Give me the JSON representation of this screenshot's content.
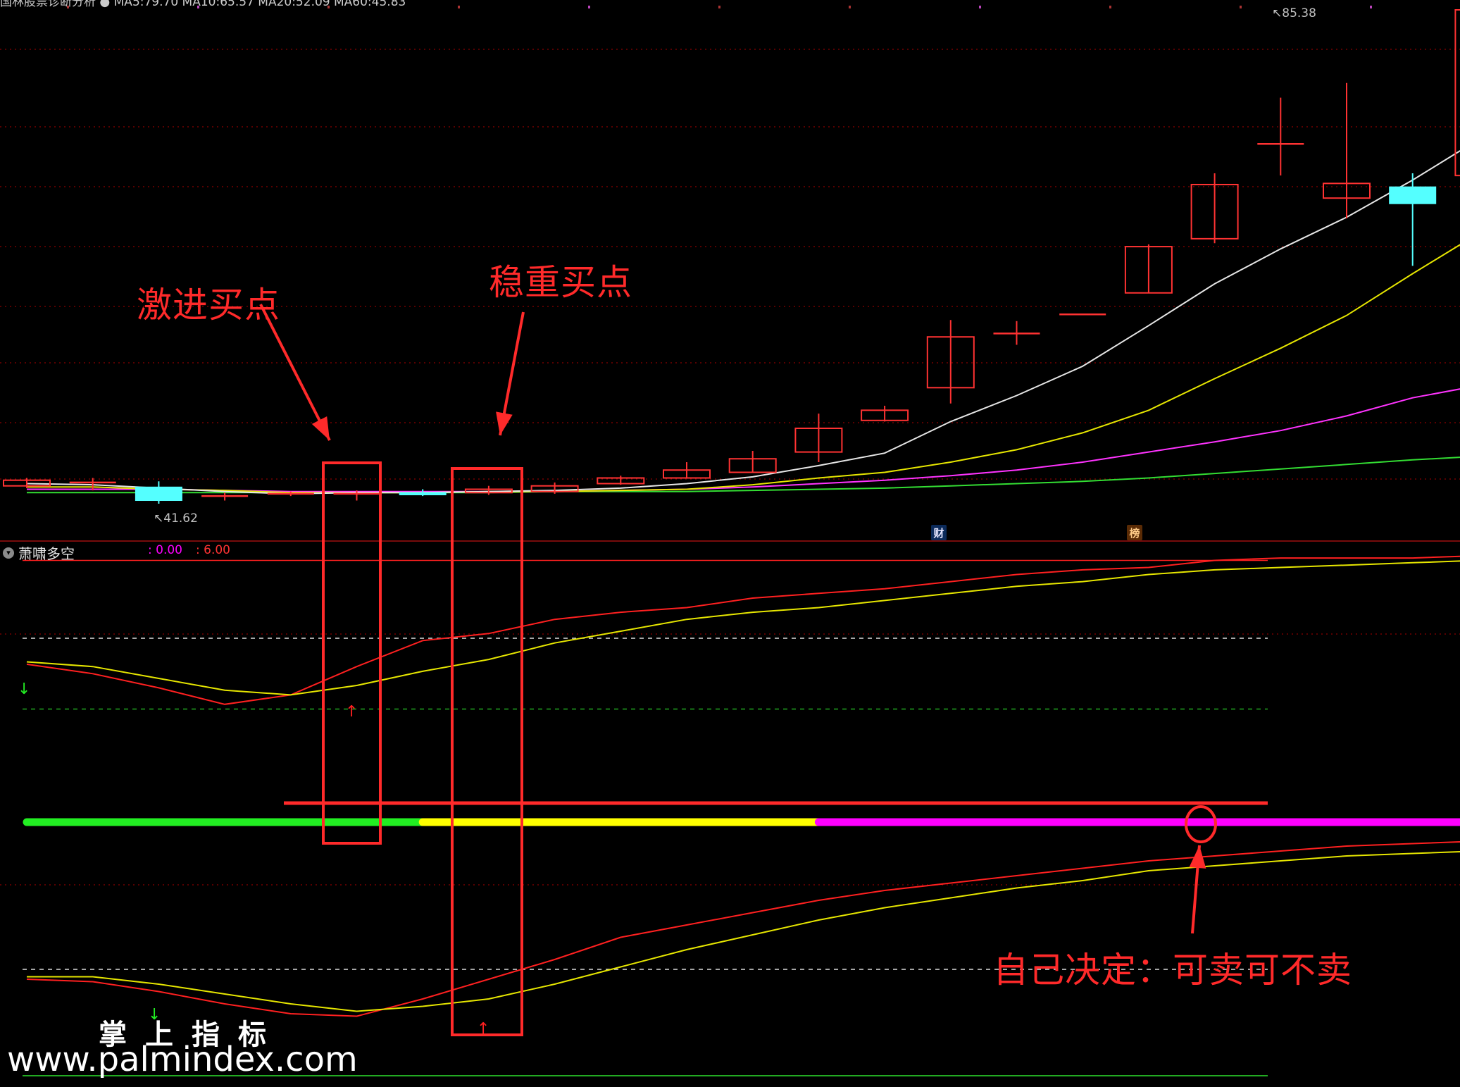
{
  "header": {
    "legend_text": "国林股票诊断分析 ● MA5:79.70 MA10:65.57 MA20:52.09 MA60:45.83"
  },
  "indicator": {
    "title": "萧啸多空",
    "value1": ": 0.00",
    "value2": ": 6.00"
  },
  "price_labels": {
    "high": "85.38",
    "low": "41.62"
  },
  "badges": {
    "cai": "财",
    "bang": "榜"
  },
  "annotations": {
    "aggressive": "激进买点",
    "steady": "稳重买点",
    "decide": "自己决定：可卖可不卖"
  },
  "watermark": {
    "cn": "掌上指标",
    "url": "www.palmindex.com"
  },
  "colors": {
    "background": "#000000",
    "up_candle": "#ff3232",
    "down_candle": "#54ffff",
    "ma5": "#e6e6e6",
    "ma10": "#e6e600",
    "ma20": "#ff33ff",
    "ma60": "#33dd33",
    "annotation": "#ff2a2a",
    "grid": "#8b0000"
  },
  "chart_data": [
    {
      "type": "candlestick",
      "title": "",
      "price_axis_max": 85.38,
      "price_axis_min": 41.62,
      "candles": [
        {
          "o": 43.2,
          "c": 43.7,
          "h": 43.9,
          "l": 43.0
        },
        {
          "o": 43.5,
          "c": 43.5,
          "h": 43.9,
          "l": 42.8
        },
        {
          "o": 43.1,
          "c": 41.9,
          "h": 43.6,
          "l": 41.62
        },
        {
          "o": 42.2,
          "c": 42.3,
          "h": 42.6,
          "l": 41.9
        },
        {
          "o": 42.4,
          "c": 42.5,
          "h": 42.7,
          "l": 42.3
        },
        {
          "o": 42.5,
          "c": 42.5,
          "h": 42.8,
          "l": 41.9
        },
        {
          "o": 42.6,
          "c": 42.4,
          "h": 42.9,
          "l": 42.3
        },
        {
          "o": 42.6,
          "c": 42.9,
          "h": 43.2,
          "l": 42.4
        },
        {
          "o": 42.7,
          "c": 43.2,
          "h": 43.5,
          "l": 42.5
        },
        {
          "o": 43.4,
          "c": 43.9,
          "h": 44.1,
          "l": 43.3
        },
        {
          "o": 43.9,
          "c": 44.6,
          "h": 45.3,
          "l": 43.9
        },
        {
          "o": 44.4,
          "c": 45.6,
          "h": 46.3,
          "l": 44.4
        },
        {
          "o": 46.2,
          "c": 48.3,
          "h": 49.6,
          "l": 45.3
        },
        {
          "o": 49.0,
          "c": 49.9,
          "h": 50.3,
          "l": 48.9
        },
        {
          "o": 51.9,
          "c": 56.4,
          "h": 57.9,
          "l": 50.5
        },
        {
          "o": 56.7,
          "c": 56.7,
          "h": 57.8,
          "l": 55.7
        },
        {
          "o": 58.4,
          "c": 58.4,
          "h": 58.4,
          "l": 58.4
        },
        {
          "o": 60.3,
          "c": 64.4,
          "h": 64.6,
          "l": 60.3
        },
        {
          "o": 65.1,
          "c": 69.9,
          "h": 70.9,
          "l": 64.7
        },
        {
          "o": 73.5,
          "c": 73.5,
          "h": 77.6,
          "l": 70.7
        },
        {
          "o": 68.7,
          "c": 70.0,
          "h": 78.9,
          "l": 66.9
        },
        {
          "o": 69.7,
          "c": 68.2,
          "h": 70.9,
          "l": 62.7
        },
        {
          "o": 70.7,
          "c": 85.38,
          "h": 85.38,
          "l": 70.7
        }
      ],
      "ma5": [
        43.4,
        43.3,
        43.0,
        42.7,
        42.5,
        42.6,
        42.6,
        42.7,
        42.8,
        43.0,
        43.4,
        44.0,
        45.0,
        46.1,
        48.9,
        51.2,
        53.8,
        57.4,
        61.1,
        64.2,
        67.0,
        70.3,
        73.9
      ],
      "ma10": [
        43.1,
        43.1,
        42.9,
        42.8,
        42.6,
        42.6,
        42.6,
        42.7,
        42.7,
        42.8,
        42.9,
        43.3,
        43.9,
        44.4,
        45.3,
        46.4,
        47.9,
        49.9,
        52.7,
        55.4,
        58.3,
        62.0,
        65.57
      ],
      "ma20": [
        42.9,
        42.9,
        42.9,
        42.8,
        42.7,
        42.7,
        42.7,
        42.7,
        42.7,
        42.8,
        42.9,
        43.1,
        43.4,
        43.7,
        44.1,
        44.6,
        45.3,
        46.2,
        47.1,
        48.1,
        49.4,
        51.0,
        52.09
      ],
      "ma60": [
        42.6,
        42.6,
        42.6,
        42.6,
        42.6,
        42.6,
        42.6,
        42.6,
        42.7,
        42.7,
        42.7,
        42.8,
        42.9,
        43.0,
        43.2,
        43.4,
        43.6,
        43.9,
        44.3,
        44.7,
        45.1,
        45.5,
        45.83
      ]
    },
    {
      "type": "line",
      "title": "萧啸多空",
      "ylim": [
        0,
        10
      ],
      "reference_levels": [
        9.3,
        6.0,
        3.0
      ],
      "series": [
        {
          "name": "",
          "color": "#ff2020",
          "values": [
            4.9,
            4.5,
            3.9,
            3.2,
            3.6,
            4.8,
            5.9,
            6.2,
            6.8,
            7.1,
            7.3,
            7.7,
            7.9,
            8.1,
            8.4,
            8.7,
            8.9,
            9.0,
            9.3,
            9.4,
            9.4,
            9.4,
            9.5
          ]
        },
        {
          "name": "",
          "color": "#e6e600",
          "values": [
            5.0,
            4.8,
            4.3,
            3.8,
            3.6,
            4.0,
            4.6,
            5.1,
            5.8,
            6.3,
            6.8,
            7.1,
            7.3,
            7.6,
            7.9,
            8.2,
            8.4,
            8.7,
            8.9,
            9.0,
            9.1,
            9.2,
            9.3
          ]
        }
      ]
    },
    {
      "type": "line",
      "title": "",
      "ylim": [
        0,
        10
      ],
      "reference_levels": [
        4.4
      ],
      "series": [
        {
          "name": "",
          "color": "#ff2020",
          "values": [
            4.0,
            3.9,
            3.5,
            3.0,
            2.6,
            2.5,
            3.2,
            4.0,
            4.8,
            5.7,
            6.2,
            6.7,
            7.2,
            7.6,
            7.9,
            8.2,
            8.5,
            8.8,
            9.0,
            9.2,
            9.4,
            9.5,
            9.6
          ]
        },
        {
          "name": "",
          "color": "#e6e600",
          "values": [
            4.1,
            4.1,
            3.8,
            3.4,
            3.0,
            2.7,
            2.9,
            3.2,
            3.8,
            4.5,
            5.2,
            5.8,
            6.4,
            6.9,
            7.3,
            7.7,
            8.0,
            8.4,
            8.6,
            8.8,
            9.0,
            9.1,
            9.2
          ]
        }
      ]
    }
  ],
  "status_bar": {
    "segments": [
      {
        "state": "green",
        "from": 0,
        "to": 6
      },
      {
        "state": "yellow",
        "from": 6,
        "to": 12
      },
      {
        "state": "magenta",
        "from": 12,
        "to": 22
      },
      {
        "state": "green",
        "from": 22,
        "to": 22.3
      },
      {
        "state": "magenta",
        "from": 22.3,
        "to": 22.9
      }
    ],
    "colors": {
      "green": "#22ee22",
      "yellow": "#ffff00",
      "magenta": "#ff00ff"
    }
  }
}
